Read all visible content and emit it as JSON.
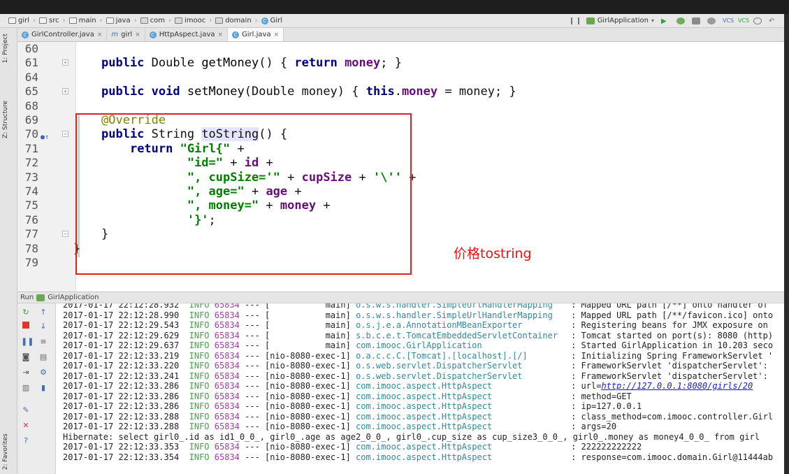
{
  "breadcrumb": [
    "girl",
    "src",
    "main",
    "java",
    "com",
    "imooc",
    "domain",
    "Girl"
  ],
  "run_config": "GirlApplication",
  "left_tabs": [
    "1: Project",
    "Z: Structure",
    "2: Favorites"
  ],
  "tabs": [
    {
      "label": "GirlController.java",
      "icon": "class-icon"
    },
    {
      "label": "girl",
      "icon": "maven-icon"
    },
    {
      "label": "HttpAspect.java",
      "icon": "class-icon"
    },
    {
      "label": "Girl.java",
      "icon": "class-icon",
      "active": true
    }
  ],
  "editor": {
    "lines": [
      {
        "n": "60",
        "html": ""
      },
      {
        "n": "61",
        "html": "<span class='kw'>public</span> Double <span class='fn'>getMoney</span>() { <span class='kw'>return</span> <span class='fld'>money</span>; }"
      },
      {
        "n": "64",
        "html": ""
      },
      {
        "n": "65",
        "html": "<span class='kw'>public void</span> <span class='fn'>setMoney</span>(Double money) { <span class='kw'>this</span>.<span class='fld'>money</span> = money; }"
      },
      {
        "n": "68",
        "html": ""
      },
      {
        "n": "69",
        "html": "<span class='ann'>@Override</span>"
      },
      {
        "n": "70",
        "html": "<span class='kw'>public</span> String <span class='hl'>toString</span>() {"
      },
      {
        "n": "71",
        "html": "    <span class='kw'>return</span> <span class='str'>\"Girl{\"</span> +"
      },
      {
        "n": "72",
        "html": "            <span class='str'>\"id=\"</span> + <span class='fld'>id</span> +"
      },
      {
        "n": "73",
        "html": "            <span class='str'>\", cupSize='\"</span> + <span class='fld'>cupSize</span> + <span class='str'>'\\''</span> +"
      },
      {
        "n": "74",
        "html": "            <span class='str'>\", age=\"</span> + <span class='fld'>age</span> +"
      },
      {
        "n": "75",
        "html": "            <span class='str'>\", money=\"</span> + <span class='fld'>money</span> +"
      },
      {
        "n": "76",
        "html": "            <span class='str'>'}'</span>;"
      },
      {
        "n": "77",
        "html": "}"
      },
      {
        "n": "78",
        "html": "}"
      },
      {
        "n": "79",
        "html": ""
      }
    ]
  },
  "annotation_note": "价格tostring",
  "run_panel": {
    "title": "Run",
    "config": "GirlApplication",
    "log": [
      {
        "ts": "2017-01-17 22:12:28.932",
        "lvl": "INFO",
        "pid": "65834",
        "thr": "[           main]",
        "logger": "o.s.w.s.handler.SimpleUrlHandlerMapping",
        "msg": ": Mapped URL path [/**] onto handler of"
      },
      {
        "ts": "2017-01-17 22:12:28.990",
        "lvl": "INFO",
        "pid": "65834",
        "thr": "[           main]",
        "logger": "o.s.w.s.handler.SimpleUrlHandlerMapping",
        "msg": ": Mapped URL path [/**/favicon.ico] onto"
      },
      {
        "ts": "2017-01-17 22:12:29.543",
        "lvl": "INFO",
        "pid": "65834",
        "thr": "[           main]",
        "logger": "o.s.j.e.a.AnnotationMBeanExporter",
        "msg": ": Registering beans for JMX exposure on"
      },
      {
        "ts": "2017-01-17 22:12:29.629",
        "lvl": "INFO",
        "pid": "65834",
        "thr": "[           main]",
        "logger": "s.b.c.e.t.TomcatEmbeddedServletContainer",
        "msg": ": Tomcat started on port(s): 8080 (http)"
      },
      {
        "ts": "2017-01-17 22:12:29.637",
        "lvl": "INFO",
        "pid": "65834",
        "thr": "[           main]",
        "logger": "com.imooc.GirlApplication",
        "msg": ": Started GirlApplication in 10.203 seco"
      },
      {
        "ts": "2017-01-17 22:12:33.219",
        "lvl": "INFO",
        "pid": "65834",
        "thr": "[nio-8080-exec-1]",
        "logger": "o.a.c.c.C.[Tomcat].[localhost].[/]",
        "msg": ": Initializing Spring FrameworkServlet '"
      },
      {
        "ts": "2017-01-17 22:12:33.220",
        "lvl": "INFO",
        "pid": "65834",
        "thr": "[nio-8080-exec-1]",
        "logger": "o.s.web.servlet.DispatcherServlet",
        "msg": ": FrameworkServlet 'dispatcherServlet':"
      },
      {
        "ts": "2017-01-17 22:12:33.241",
        "lvl": "INFO",
        "pid": "65834",
        "thr": "[nio-8080-exec-1]",
        "logger": "o.s.web.servlet.DispatcherServlet",
        "msg": ": FrameworkServlet 'dispatcherServlet':"
      },
      {
        "ts": "2017-01-17 22:12:33.286",
        "lvl": "INFO",
        "pid": "65834",
        "thr": "[nio-8080-exec-1]",
        "logger": "com.imooc.aspect.HttpAspect",
        "msg": ": url=",
        "link": "http://127.0.0.1:8080/girls/20"
      },
      {
        "ts": "2017-01-17 22:12:33.286",
        "lvl": "INFO",
        "pid": "65834",
        "thr": "[nio-8080-exec-1]",
        "logger": "com.imooc.aspect.HttpAspect",
        "msg": ": method=GET"
      },
      {
        "ts": "2017-01-17 22:12:33.286",
        "lvl": "INFO",
        "pid": "65834",
        "thr": "[nio-8080-exec-1]",
        "logger": "com.imooc.aspect.HttpAspect",
        "msg": ": ip=127.0.0.1"
      },
      {
        "ts": "2017-01-17 22:12:33.288",
        "lvl": "INFO",
        "pid": "65834",
        "thr": "[nio-8080-exec-1]",
        "logger": "com.imooc.aspect.HttpAspect",
        "msg": ": class_method=com.imooc.controller.Girl"
      },
      {
        "ts": "2017-01-17 22:12:33.288",
        "lvl": "INFO",
        "pid": "65834",
        "thr": "[nio-8080-exec-1]",
        "logger": "com.imooc.aspect.HttpAspect",
        "msg": ": args=20"
      },
      {
        "plain": "Hibernate: select girl0_.id as id1_0_0_, girl0_.age as age2_0_0_, girl0_.cup_size as cup_size3_0_0_, girl0_.money as money4_0_0_ from girl"
      },
      {
        "ts": "2017-01-17 22:12:33.353",
        "lvl": "INFO",
        "pid": "65834",
        "thr": "[nio-8080-exec-1]",
        "logger": "com.imooc.aspect.HttpAspect",
        "msg": ": 222222222222"
      },
      {
        "ts": "2017-01-17 22:12:33.354",
        "lvl": "INFO",
        "pid": "65834",
        "thr": "[nio-8080-exec-1]",
        "logger": "com.imooc.aspect.HttpAspect",
        "msg": ": response=com.imooc.domain.Girl@11444ab"
      }
    ]
  }
}
